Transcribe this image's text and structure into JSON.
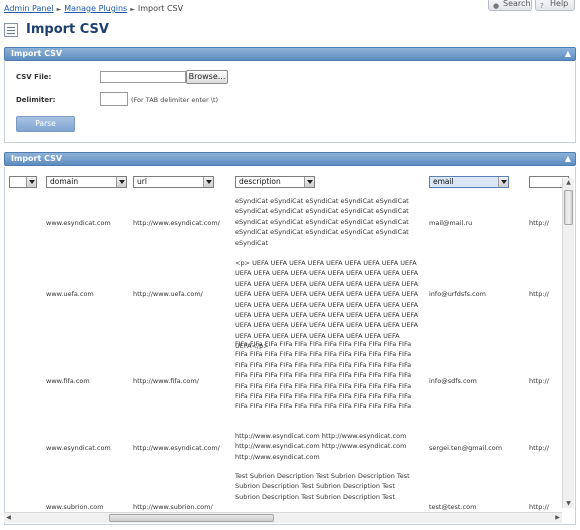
{
  "breadcrumb": {
    "items": [
      "Admin Panel",
      "Manage Plugins"
    ],
    "current": "Import CSV"
  },
  "top_buttons": {
    "search": "Search",
    "help": "Help"
  },
  "page_title": "Import CSV",
  "upload_panel": {
    "title": "Import CSV",
    "csv_file_label": "CSV File:",
    "browse_label": "Browse...",
    "delimiter_label": "Delimiter:",
    "delimiter_value": "",
    "delimiter_hint": "(For TAB delimiter enter \\t)",
    "parse_label": "Parse"
  },
  "table_panel": {
    "title": "Import CSV",
    "columns": [
      "",
      "domain",
      "url",
      "description",
      "email",
      ""
    ],
    "rows": [
      {
        "domain": "www.esyndicat.com",
        "url": "http://www.esyndicat.com/",
        "description": "eSyndiCat eSyndiCat eSyndiCat eSyndiCat eSyndiCat eSyndiCat eSyndiCat eSyndiCat eSyndiCat eSyndiCat eSyndiCat eSyndiCat eSyndiCat eSyndiCat eSyndiCat eSyndiCat eSyndiCat eSyndiCat eSyndiCat eSyndiCat eSyndiCat",
        "email": "mail@mail.ru",
        "extra": "http://"
      },
      {
        "domain": "www.uefa.com",
        "url": "http://www.uefa.com/",
        "description": "<p> UEFA UEFA UEFA UEFA UEFA UEFA UEFA UEFA UEFA UEFA UEFA UEFA UEFA UEFA UEFA UEFA UEFA UEFA UEFA UEFA UEFA UEFA UEFA UEFA UEFA UEFA UEFA UEFA UEFA UEFA UEFA UEFA UEFA UEFA UEFA UEFA UEFA UEFA UEFA UEFA UEFA UEFA UEFA UEFA UEFA UEFA UEFA UEFA UEFA UEFA UEFA UEFA UEFA UEFA UEFA UEFA UEFA UEFA UEFA UEFA UEFA UEFA UEFA UEFA UEFA UEFA UEFA UEFA UEFA UEFA UEFA UEFA UEFA UEFA UEFA UEFA UEFA UEFA UEFA</p>",
        "email": "info@urfdsfs.com",
        "extra": "http://"
      },
      {
        "domain": "www.fifa.com",
        "url": "http://www.fifa.com/",
        "description": "FIFa FIFa FIFa FIFa FIFa FIFa FIFa FIFa FIFa FIFa FIFa FIFa FIFa FIFa FIFa FIFa FIFa FIFa FIFa FIFa FIFa FIFa FIFa FIFa FIFa FIFa FIFa FIFa FIFa FIFa FIFa FIFa FIFa FIFa FIFa FIFa FIFa FIFa FIFa FIFa FIFa FIFa FIFa FIFa FIFa FIFa FIFa FIFa FIFa FIFa FIFa FIFa FIFa FIFa FIFa FIFa FIFa FIFa FIFa FIFa FIFa FIFa FIFa FIFa FIFa FIFa FIFa FIFa FIFa FIFa FIFa FIFa FIFa FIFa FIFa FIFa FIFa FIFa FIFa FIFa FIFa FIFa FIFa FIFa",
        "email": "info@sdfs.com",
        "extra": "http://"
      },
      {
        "domain": "www.esyndicat.com",
        "url": "http://www.esyndicat.com/",
        "description": "http://www.esyndicat.com http://www.esyndicat.com http://www.esyndicat.com http://www.esyndicat.com http://www.esyndicat.com",
        "email": "sergei.ten@gmail.com",
        "extra": "http://"
      },
      {
        "domain": "www.subrion.com",
        "url": "http://www.subrion.com/",
        "description": "Test Subrion Description Test Subrion Description Test Subrion Description Test Subrion Description Test Subrion Description Test Subrion Description Test",
        "email": "test@test.com",
        "extra": "http://"
      }
    ]
  },
  "icons": {
    "search": "search-icon",
    "help": "help-icon",
    "page": "import-csv-icon",
    "collapse": "collapse-arrow-icon",
    "dropdown": "chevron-down-icon"
  },
  "colors": {
    "panel_header": "#6f9acb",
    "title": "#1f3f6e",
    "link": "#1e5aa8",
    "parse_button": "#8fb0d8"
  }
}
